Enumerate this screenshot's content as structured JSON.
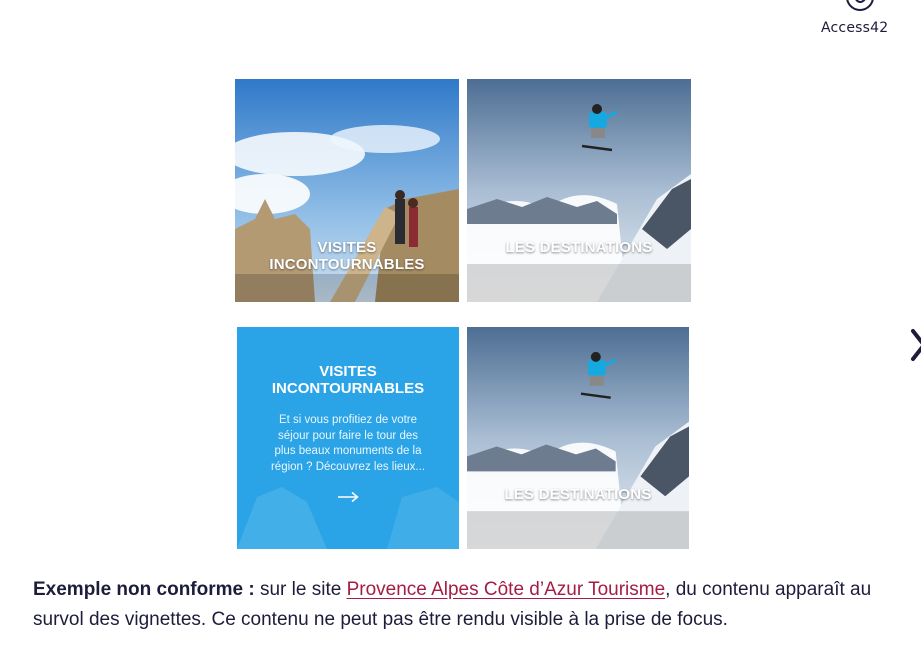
{
  "logo": {
    "text": "Access42",
    "icon": "access42-logo-icon"
  },
  "nav": {
    "next_icon": "chevron-right-icon"
  },
  "tiles": {
    "visits_1": {
      "label_line1": "VISITES",
      "label_line2": "INCONTOURNABLES"
    },
    "dest_1": {
      "label": "LES DESTINATIONS"
    },
    "visits_2": {
      "title_line1": "VISITES",
      "title_line2": "INCONTOURNABLES",
      "desc_line1": "Et si vous profitiez de votre",
      "desc_line2": "séjour pour faire le tour des",
      "desc_line3": "plus beaux monuments de la",
      "desc_line4": "région ? Découvrez les lieux...",
      "arrow_icon": "arrow-right-icon"
    },
    "dest_2": {
      "label": "LES DESTINATIONS"
    }
  },
  "caption": {
    "bold": "Exemple non conforme :",
    "pre_link": " sur le site ",
    "link_text": "Provence Alpes Côte d’Azur Tourisme",
    "post_link": ", du contenu apparaît au survol des vignettes. Ce contenu ne peut pas être rendu visible à la prise de focus."
  },
  "colors": {
    "text": "#1d1d3b",
    "link": "#a41d45",
    "hover_tile": "#2aa4e6"
  }
}
